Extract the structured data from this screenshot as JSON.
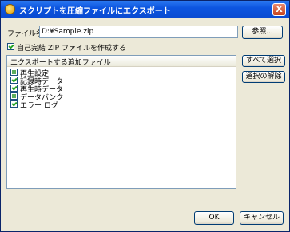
{
  "window": {
    "title": "スクリプトを圧縮ファイルにエクスポート",
    "close_label": "X"
  },
  "file": {
    "label": "ファイル名:",
    "value": "D:¥Sample.zip",
    "browse_label": "参照..."
  },
  "self_extract": {
    "label": "自己完結 ZIP ファイルを作成する",
    "checked": true
  },
  "list": {
    "header": "エクスポートする追加ファイル",
    "items": [
      {
        "label": "再生設定",
        "state": "partial"
      },
      {
        "label": "記録時データ",
        "state": "checked"
      },
      {
        "label": "再生時データ",
        "state": "checked"
      },
      {
        "label": "データバンク",
        "state": "partial"
      },
      {
        "label": "エラー ログ",
        "state": "checked"
      }
    ]
  },
  "side_buttons": {
    "select_all": "すべて選択",
    "deselect": "選択の解除"
  },
  "footer": {
    "ok": "OK",
    "cancel": "キャンセル"
  }
}
